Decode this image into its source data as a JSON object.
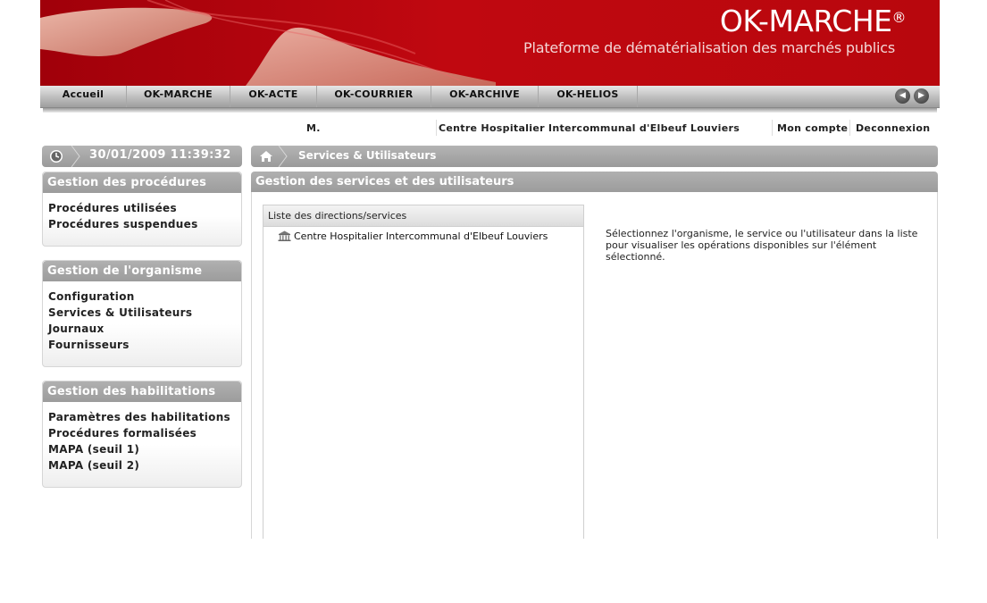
{
  "banner": {
    "brand": "OK-MARCHE",
    "registered": "®",
    "tagline": "Plateforme de dématérialisation des marchés publics"
  },
  "nav": {
    "items": [
      "Accueil",
      "OK-MARCHE",
      "OK-ACTE",
      "OK-COURRIER",
      "OK-ARCHIVE",
      "OK-HELIOS"
    ],
    "prev_icon": "arrow-left-icon",
    "next_icon": "arrow-right-icon"
  },
  "userbar": {
    "user": "M.",
    "organisation": "Centre Hospitalier Intercommunal d'Elbeuf Louviers",
    "account": "Mon compte",
    "logout": "Deconnexion"
  },
  "clockbar": {
    "datetime": "30/01/2009 11:39:32",
    "icon": "clock-icon"
  },
  "breadcrumb": {
    "current": "Services & Utilisateurs",
    "icon": "home-icon"
  },
  "sidebar": {
    "sections": [
      {
        "title": "Gestion des procédures",
        "items": [
          "Procédures utilisées",
          "Procédures suspendues"
        ]
      },
      {
        "title": "Gestion de l'organisme",
        "items": [
          "Configuration",
          "Services & Utilisateurs",
          "Journaux",
          "Fournisseurs"
        ]
      },
      {
        "title": "Gestion des habilitations",
        "items": [
          "Paramètres des habilitations",
          "Procédures formalisées",
          "MAPA (seuil 1)",
          "MAPA (seuil 2)"
        ]
      }
    ]
  },
  "main": {
    "title": "Gestion des services et des utilisateurs",
    "tree": {
      "header": "Liste des directions/services",
      "root": "Centre Hospitalier Intercommunal d'Elbeuf Louviers",
      "root_icon": "building-icon"
    },
    "info": "Sélectionnez l'organisme, le service ou l'utilisateur dans la liste pour visualiser les opérations disponibles sur l'élément sélectionné."
  },
  "colors": {
    "banner_red": "#c00810",
    "header_gray": "#a4a4a4"
  }
}
